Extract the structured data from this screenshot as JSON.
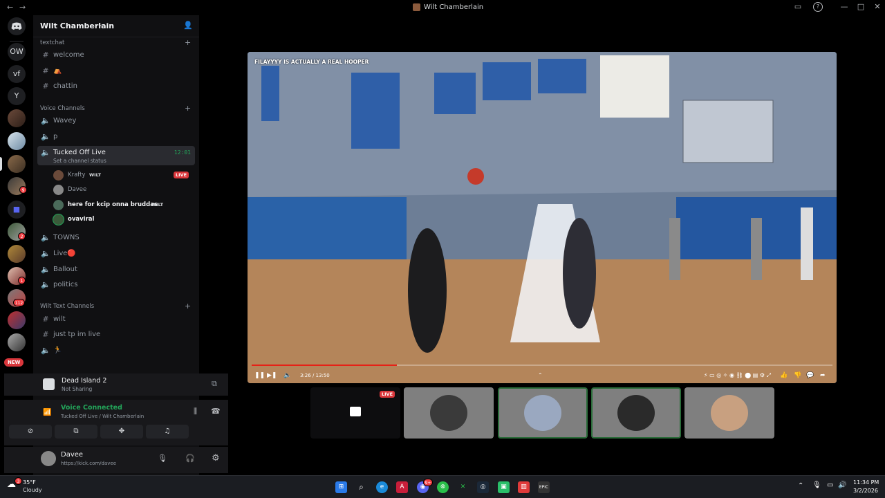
{
  "window": {
    "title": "Wilt Chamberlain",
    "back_icon": "arrow-left-icon",
    "forward_icon": "arrow-right-icon"
  },
  "guilds": {
    "items": [
      {
        "label": "OW"
      },
      {
        "label": "vf"
      },
      {
        "label": "Y"
      }
    ],
    "badges": [
      "2",
      "1",
      "112",
      "9"
    ],
    "new_label": "NEW"
  },
  "server": {
    "name": "Wilt Chamberlain",
    "categories": {
      "textchat": "textchat",
      "voice": "Voice Channels",
      "wilt_text": "Wilt Text Channels"
    },
    "text_channels": [
      "welcome",
      "⛺",
      "chattin"
    ],
    "voice_channels_top": [
      "Wavey",
      "p"
    ],
    "active_voice": {
      "name": "Tucked Off Live",
      "status": "Set a channel status",
      "time": "12:01"
    },
    "voice_users": [
      {
        "name": "Krafty",
        "tag": "WILT",
        "live": "LIVE"
      },
      {
        "name": "Davee"
      },
      {
        "name": "here for kcip onna bruddas",
        "tag": "WILT"
      },
      {
        "name": "ovaviral"
      }
    ],
    "voice_channels_bottom": [
      "TOWNS",
      "Live🔴",
      "Ballout",
      "politics"
    ],
    "wilt_text_channels": [
      "wilt",
      "just tp im live"
    ],
    "wilt_voice_channels": [
      "🏃"
    ]
  },
  "activity": {
    "title": "Dead Island 2",
    "subtitle": "Not Sharing"
  },
  "voice_connected": {
    "status": "Voice Connected",
    "channel": "Tucked Off Live / Wilt Chamberlain"
  },
  "user": {
    "name": "Davee",
    "status": "https://kick.com/davee"
  },
  "stream": {
    "overlay_text": "FILAYYYY IS ACTUALLY A  REAL HOOPER",
    "time": "3:26 / 13:50",
    "progress": 0.25
  },
  "tiles": {
    "live_label": "LIVE"
  },
  "taskbar": {
    "weather_temp": "35°F",
    "weather_desc": "Cloudy",
    "time": "11:34 PM",
    "date": "3/2/2026",
    "weather_badge": "3",
    "discord_badge": "9+"
  },
  "colors": {
    "accent_green": "#23a55a",
    "live_red": "#da373c",
    "bg": "#000000",
    "sidebar": "#101012"
  }
}
